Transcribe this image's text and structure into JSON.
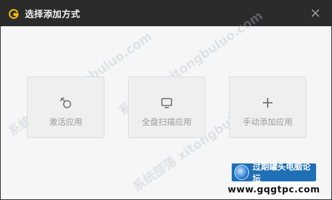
{
  "window": {
    "title": "选择添加方式",
    "close_label": "×"
  },
  "options": [
    {
      "label": "激活应用",
      "icon": "activate-app-icon"
    },
    {
      "label": "全盘扫描应用",
      "icon": "monitor-scan-icon"
    },
    {
      "label": "手动添加应用",
      "icon": "plus-icon"
    }
  ],
  "watermark": {
    "text": "系统部落 xitongbuluo.com",
    "logo_text": "过期罐头电脑论坛",
    "url": "www.gqgtpc.com"
  },
  "colors": {
    "titlebar": "#2b2b2b",
    "logo_accent": "#f2b705",
    "card_border": "#dcdcdc",
    "card_text": "#9a9a9a"
  }
}
